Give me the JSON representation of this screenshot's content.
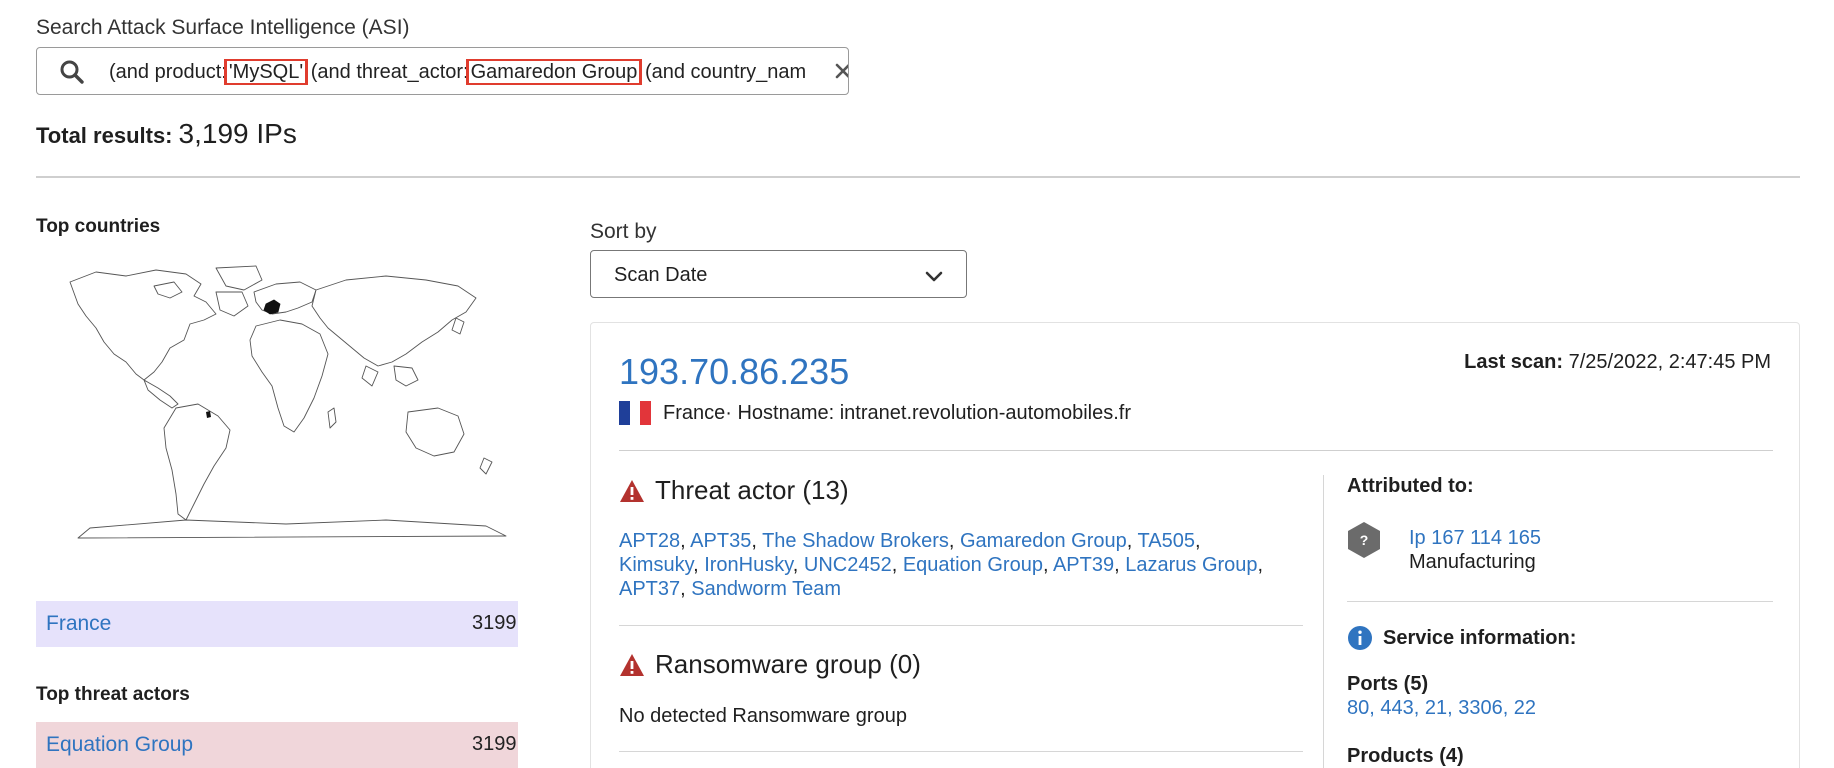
{
  "search": {
    "label": "Search Attack Surface Intelligence (ASI)",
    "query_parts": [
      "(and product:",
      "'MySQL'",
      " (and threat_actor:",
      "Gamaredon Group",
      " (and country_nam"
    ]
  },
  "summary": {
    "total_label": "Total results:",
    "total_value": "3,199 IPs"
  },
  "left": {
    "top_countries_title": "Top countries",
    "countries": [
      {
        "label": "France",
        "count": "3199",
        "color": "#e6e2fb"
      }
    ],
    "top_threat_actors_title": "Top threat actors",
    "threat_actors": [
      {
        "label": "Equation Group",
        "count": "3199",
        "color": "#f0d6da"
      }
    ]
  },
  "sort": {
    "label": "Sort by",
    "value": "Scan Date"
  },
  "result": {
    "ip": "193.70.86.235",
    "last_scan_label": "Last scan:",
    "last_scan_value": "7/25/2022, 2:47:45 PM",
    "country": "France",
    "hostname_text": " · Hostname: intranet.revolution-automobiles.fr",
    "flag_colors": [
      "#1f3f99",
      "#ffffff",
      "#e2353a"
    ],
    "threat_actor_title": "Threat actor (13)",
    "threat_actors": [
      "APT28",
      "APT35",
      "The Shadow Brokers",
      "Gamaredon Group",
      "TA505",
      "Kimsuky",
      "IronHusky",
      "UNC2452",
      "Equation Group",
      "APT39",
      "Lazarus Group",
      "APT37",
      "Sandworm Team"
    ],
    "ransomware_title": "Ransomware group (0)",
    "ransomware_empty": "No detected Ransomware group",
    "attributed_title": "Attributed to:",
    "attributed_name": "Ip 167 114 165",
    "attributed_sector": "Manufacturing",
    "service_title": "Service information:",
    "ports_title": "Ports (5)",
    "ports": "80, 443, 21, 3306, 22",
    "products_title": "Products (4)"
  },
  "icons": {
    "search": "search-icon",
    "clear": "close-icon",
    "chevron": "chevron-down-icon",
    "warning": "warning-icon",
    "info": "info-icon",
    "hex": "unknown-hexagon-icon"
  },
  "colors": {
    "link": "#2f74c0",
    "highlight_outline": "#e03c2e",
    "warning": "#b3322e",
    "info": "#2f74c0"
  }
}
